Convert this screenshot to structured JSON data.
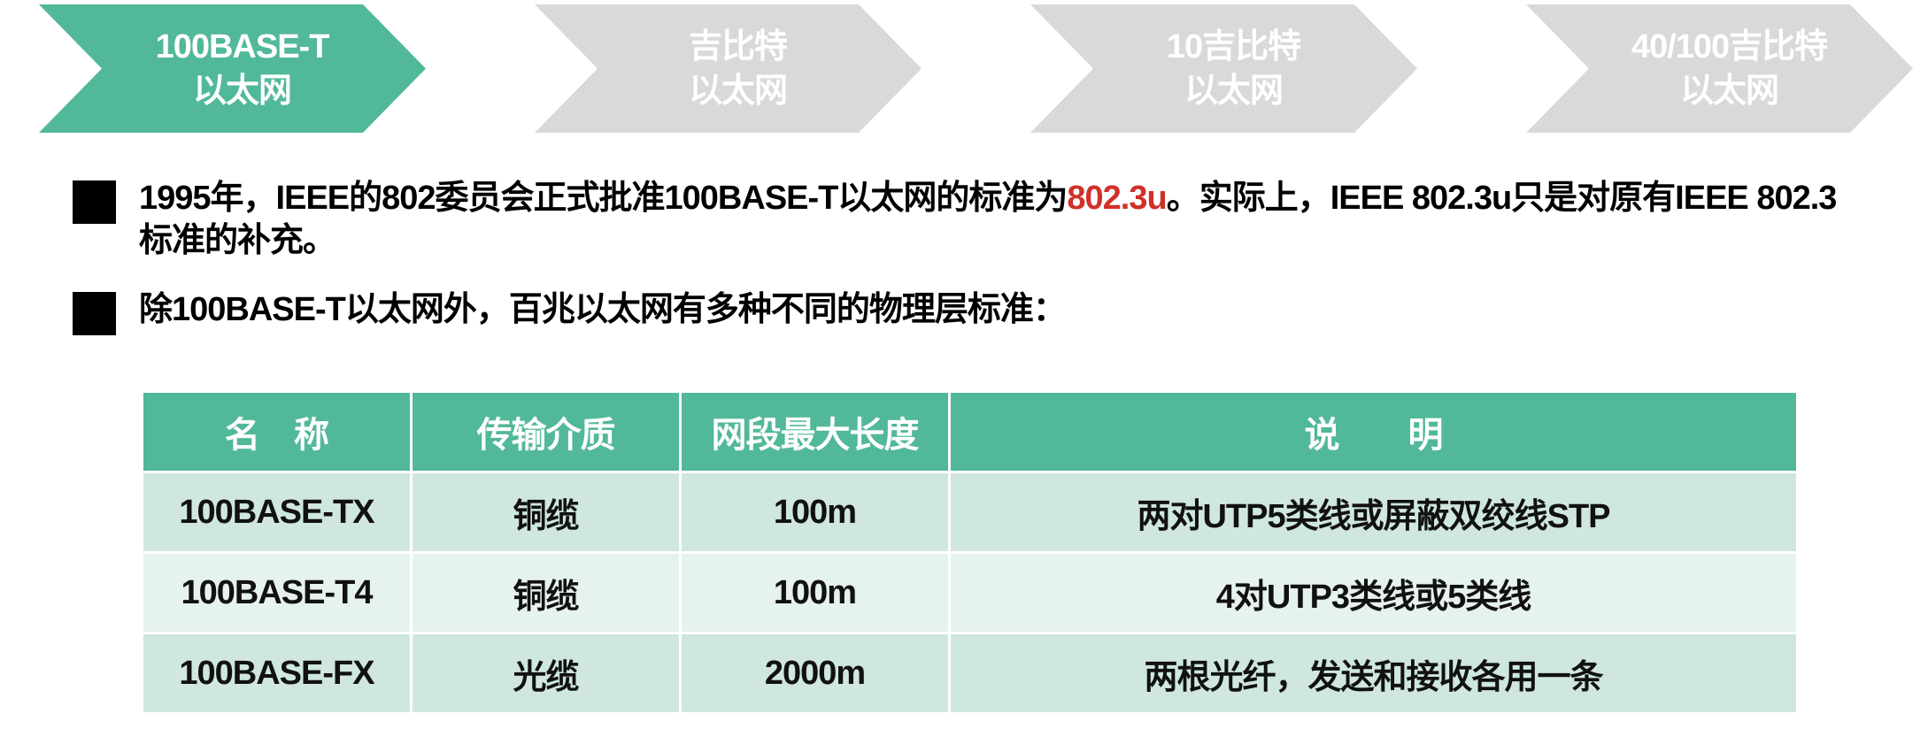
{
  "colors": {
    "active_step": "#52b89a",
    "inactive_step": "#d9d9d9",
    "highlight_text": "#d0302a",
    "table_header": "#52b89a",
    "table_row_dark": "#cfe7dd",
    "table_row_light": "#e6f2ed"
  },
  "steps": [
    {
      "line1": "100BASE-T",
      "line2": "以太网",
      "active": true
    },
    {
      "line1": "吉比特",
      "line2": "以太网",
      "active": false
    },
    {
      "line1": "10吉比特",
      "line2": "以太网",
      "active": false
    },
    {
      "line1": "40/100吉比特",
      "line2": "以太网",
      "active": false
    }
  ],
  "bullets": {
    "b1_before": "1995年，IEEE的802委员会正式批准100BASE-T以太网的标准为",
    "b1_highlight": "802.3u",
    "b1_after": "。实际上，IEEE 802.3u只是对原有IEEE 802.3标准的补充。",
    "b2": "除100BASE-T以太网外，百兆以太网有多种不同的物理层标准："
  },
  "table": {
    "headers": [
      "名　称",
      "传输介质",
      "网段最大长度",
      "说　　明"
    ],
    "rows": [
      [
        "100BASE-TX",
        "铜缆",
        "100m",
        "两对UTP5类线或屏蔽双绞线STP"
      ],
      [
        "100BASE-T4",
        "铜缆",
        "100m",
        "4对UTP3类线或5类线"
      ],
      [
        "100BASE-FX",
        "光缆",
        "2000m",
        "两根光纤，发送和接收各用一条"
      ]
    ]
  }
}
